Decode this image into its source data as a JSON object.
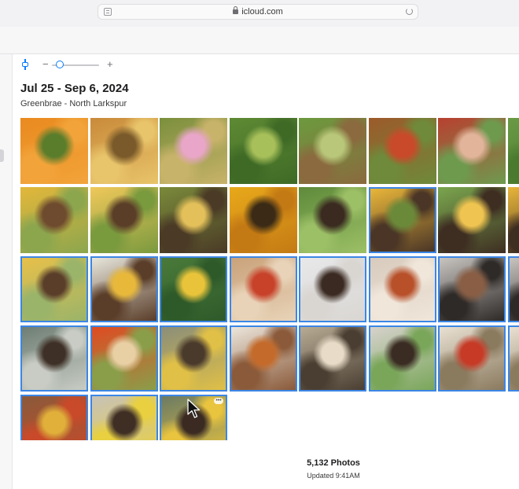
{
  "browser": {
    "url": "icloud.com"
  },
  "library": {
    "date_range": "Jul 25 - Sep 6, 2024",
    "location": "Greenbrae - North Larkspur",
    "zoom_level": 0.1
  },
  "grid": {
    "rows": [
      [
        {
          "subject": "orange squash on leaves",
          "selected": false,
          "colors": [
            "#e98a1f",
            "#5a7d2c",
            "#f2a43a"
          ]
        },
        {
          "subject": "hand holding vegetable",
          "selected": false,
          "colors": [
            "#c98a3a",
            "#7a5a2a",
            "#e8c46a"
          ]
        },
        {
          "subject": "pink flowers",
          "selected": false,
          "colors": [
            "#7a8f3c",
            "#e9a6c8",
            "#c8b36a"
          ]
        },
        {
          "subject": "garden greens",
          "selected": false,
          "colors": [
            "#5e8a34",
            "#a8c05a",
            "#3e6a26"
          ]
        },
        {
          "subject": "person in garden",
          "selected": false,
          "colors": [
            "#6c9a3e",
            "#b9c77a",
            "#8a6a3e"
          ]
        },
        {
          "subject": "bowl of produce",
          "selected": false,
          "colors": [
            "#9c5a2a",
            "#c94a2a",
            "#6e8a3a"
          ]
        },
        {
          "subject": "hands holding strawberry",
          "selected": false,
          "colors": [
            "#b84030",
            "#e2b49a",
            "#6e9a4e"
          ]
        },
        {
          "subject": "green plants",
          "selected": false,
          "colors": [
            "#6a9a44",
            "#d9c46a",
            "#4a7a2e"
          ]
        }
      ],
      [
        {
          "subject": "two girls smiling",
          "selected": false,
          "colors": [
            "#e3b73a",
            "#6e4a2e",
            "#8ca64e"
          ]
        },
        {
          "subject": "father and daughter",
          "selected": false,
          "colors": [
            "#f0c85a",
            "#5a3e28",
            "#7a9a3e"
          ]
        },
        {
          "subject": "girl picking",
          "selected": false,
          "colors": [
            "#7a8a3a",
            "#e3c05a",
            "#4a3a26"
          ]
        },
        {
          "subject": "yellow black-eyed susans",
          "selected": false,
          "colors": [
            "#e8a91a",
            "#3a2a16",
            "#c47a14"
          ]
        },
        {
          "subject": "woman holding cucumber",
          "selected": false,
          "colors": [
            "#5e8a3a",
            "#3a2a20",
            "#9cc066"
          ]
        },
        {
          "subject": "family with basket",
          "selected": true,
          "colors": [
            "#e9b63a",
            "#6a8a3a",
            "#4a3526"
          ]
        },
        {
          "subject": "kids in greens",
          "selected": false,
          "colors": [
            "#7aa64e",
            "#f0c450",
            "#3e2e22"
          ]
        },
        {
          "subject": "partial",
          "selected": false,
          "colors": [
            "#e9b63a",
            "#6a8a3a",
            "#3e2e22"
          ]
        }
      ],
      [
        {
          "subject": "girls holding corn",
          "selected": true,
          "colors": [
            "#e8c04a",
            "#5a3e2a",
            "#9ab46a"
          ]
        },
        {
          "subject": "father and daughter yellow",
          "selected": true,
          "colors": [
            "#e8e6dc",
            "#e8b83a",
            "#5a3e2a"
          ]
        },
        {
          "subject": "yellow flowers",
          "selected": true,
          "colors": [
            "#4a7a3a",
            "#e9c43a",
            "#2e5a2a"
          ]
        },
        {
          "subject": "bowl of tomatoes",
          "selected": true,
          "colors": [
            "#c9a27a",
            "#c8422a",
            "#e8d3b8"
          ]
        },
        {
          "subject": "woman portrait",
          "selected": true,
          "colors": [
            "#e8e8ea",
            "#3a2a22",
            "#d9d6d2"
          ]
        },
        {
          "subject": "bowl of cherry tomatoes",
          "selected": true,
          "colors": [
            "#d8cbbd",
            "#b8502a",
            "#f0e6da"
          ]
        },
        {
          "subject": "bread on plate",
          "selected": true,
          "colors": [
            "#c8c4c0",
            "#8a5e44",
            "#2e2a28"
          ]
        },
        {
          "subject": "partial",
          "selected": true,
          "colors": [
            "#c8c4c0",
            "#8a5e44",
            "#2e2a28"
          ]
        }
      ],
      [
        {
          "subject": "man and girl cooking",
          "selected": true,
          "colors": [
            "#6e7e74",
            "#3e3026",
            "#c8ccc4"
          ]
        },
        {
          "subject": "sliced peppers",
          "selected": true,
          "colors": [
            "#e04a22",
            "#e8cfa4",
            "#8a9e4a"
          ]
        },
        {
          "subject": "family in kitchen",
          "selected": true,
          "colors": [
            "#8a8e7a",
            "#4a3a2c",
            "#e0c046"
          ]
        },
        {
          "subject": "bowls of ingredients",
          "selected": true,
          "colors": [
            "#ece6dc",
            "#c46a2a",
            "#8a5a3a"
          ]
        },
        {
          "subject": "sliced bread",
          "selected": true,
          "colors": [
            "#b8ab94",
            "#e8dcc8",
            "#4a3e32"
          ]
        },
        {
          "subject": "girl at counter",
          "selected": true,
          "colors": [
            "#d6d2cc",
            "#3a2c22",
            "#7aa65a"
          ]
        },
        {
          "subject": "mushrooms and tomatoes",
          "selected": true,
          "colors": [
            "#e8e0d2",
            "#c63a26",
            "#8a7a5e"
          ]
        },
        {
          "subject": "partial",
          "selected": true,
          "colors": [
            "#e8e0d2",
            "#c63a26",
            "#8a7a5e"
          ]
        }
      ],
      [
        {
          "subject": "vegetable skewers",
          "selected": true,
          "colors": [
            "#8a5a3a",
            "#e0b03a",
            "#c84a2a"
          ]
        },
        {
          "subject": "family cooking",
          "selected": true,
          "colors": [
            "#c8c2b8",
            "#3e2e24",
            "#e8d040"
          ]
        },
        {
          "subject": "father and daughters",
          "selected": true,
          "colors": [
            "#6a7a64",
            "#3a2a22",
            "#e9c43e"
          ]
        }
      ]
    ]
  },
  "footer": {
    "count": "5,132 Photos",
    "updated": "Updated 9:41AM"
  }
}
